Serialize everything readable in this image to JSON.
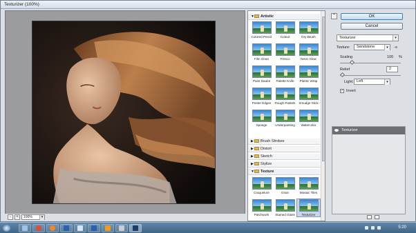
{
  "window": {
    "title": "Texturizer (100%)"
  },
  "zoom": {
    "value": "100%",
    "minus": "-",
    "plus": "+"
  },
  "buttons": {
    "ok": "OK",
    "cancel": "Cancel"
  },
  "filter_select": {
    "value": "Texturizer"
  },
  "settings": {
    "texture_label": "Texture:",
    "texture_value": "Sandstone",
    "texture_menu_glyph": "-≡",
    "scaling_label": "Scaling",
    "scaling_value": "100",
    "scaling_unit": "%",
    "scaling_fraction": 0.2,
    "relief_label": "Relief",
    "relief_value": "2",
    "relief_fraction": 0.04,
    "light_label": "Light:",
    "light_value": "Left",
    "invert_label": "Invert",
    "invert_checked": true
  },
  "gallery": {
    "categories": [
      {
        "label": "Artistic",
        "open": true
      },
      {
        "label": "Brush Strokes",
        "open": false
      },
      {
        "label": "Distort",
        "open": false
      },
      {
        "label": "Sketch",
        "open": false
      },
      {
        "label": "Stylize",
        "open": false
      },
      {
        "label": "Texture",
        "open": true
      }
    ],
    "artistic": [
      "Colored Pencil",
      "Cutout",
      "Dry Brush",
      "Film Grain",
      "Fresco",
      "Neon Glow",
      "Paint Daubs",
      "Palette Knife",
      "Plastic Wrap",
      "Poster Edges",
      "Rough Pastels",
      "Smudge Stick",
      "Sponge",
      "Underpainting",
      "Watercolor"
    ],
    "texture": [
      "Craquelure",
      "Grain",
      "Mosaic Tiles",
      "Patchwork",
      "Stained Glass",
      "Texturizer"
    ],
    "selected": "Texturizer"
  },
  "layers": {
    "effect_name": "Texturizer"
  },
  "taskbar": {
    "time": "5:20"
  },
  "colors": {
    "accent": "#3c7fb1",
    "selected_layer": "#6b6e73",
    "canvas_bg": "#9a9c9f"
  }
}
